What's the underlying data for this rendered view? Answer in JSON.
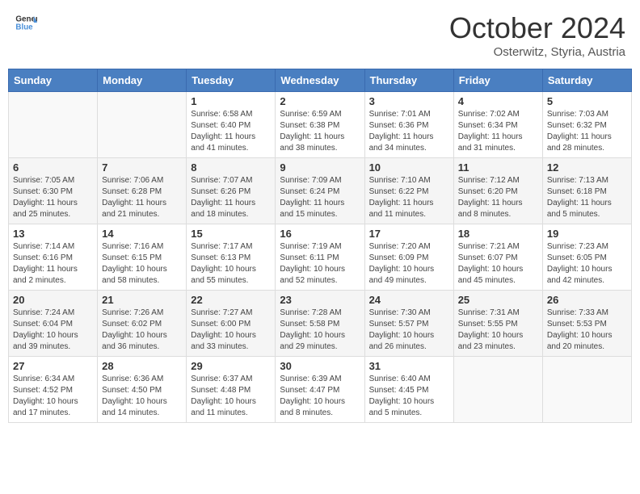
{
  "header": {
    "logo_general": "General",
    "logo_blue": "Blue",
    "title": "October 2024",
    "location": "Osterwitz, Styria, Austria"
  },
  "calendar": {
    "weekdays": [
      "Sunday",
      "Monday",
      "Tuesday",
      "Wednesday",
      "Thursday",
      "Friday",
      "Saturday"
    ],
    "weeks": [
      [
        {
          "day": "",
          "info": ""
        },
        {
          "day": "",
          "info": ""
        },
        {
          "day": "1",
          "info": "Sunrise: 6:58 AM\nSunset: 6:40 PM\nDaylight: 11 hours and 41 minutes."
        },
        {
          "day": "2",
          "info": "Sunrise: 6:59 AM\nSunset: 6:38 PM\nDaylight: 11 hours and 38 minutes."
        },
        {
          "day": "3",
          "info": "Sunrise: 7:01 AM\nSunset: 6:36 PM\nDaylight: 11 hours and 34 minutes."
        },
        {
          "day": "4",
          "info": "Sunrise: 7:02 AM\nSunset: 6:34 PM\nDaylight: 11 hours and 31 minutes."
        },
        {
          "day": "5",
          "info": "Sunrise: 7:03 AM\nSunset: 6:32 PM\nDaylight: 11 hours and 28 minutes."
        }
      ],
      [
        {
          "day": "6",
          "info": "Sunrise: 7:05 AM\nSunset: 6:30 PM\nDaylight: 11 hours and 25 minutes."
        },
        {
          "day": "7",
          "info": "Sunrise: 7:06 AM\nSunset: 6:28 PM\nDaylight: 11 hours and 21 minutes."
        },
        {
          "day": "8",
          "info": "Sunrise: 7:07 AM\nSunset: 6:26 PM\nDaylight: 11 hours and 18 minutes."
        },
        {
          "day": "9",
          "info": "Sunrise: 7:09 AM\nSunset: 6:24 PM\nDaylight: 11 hours and 15 minutes."
        },
        {
          "day": "10",
          "info": "Sunrise: 7:10 AM\nSunset: 6:22 PM\nDaylight: 11 hours and 11 minutes."
        },
        {
          "day": "11",
          "info": "Sunrise: 7:12 AM\nSunset: 6:20 PM\nDaylight: 11 hours and 8 minutes."
        },
        {
          "day": "12",
          "info": "Sunrise: 7:13 AM\nSunset: 6:18 PM\nDaylight: 11 hours and 5 minutes."
        }
      ],
      [
        {
          "day": "13",
          "info": "Sunrise: 7:14 AM\nSunset: 6:16 PM\nDaylight: 11 hours and 2 minutes."
        },
        {
          "day": "14",
          "info": "Sunrise: 7:16 AM\nSunset: 6:15 PM\nDaylight: 10 hours and 58 minutes."
        },
        {
          "day": "15",
          "info": "Sunrise: 7:17 AM\nSunset: 6:13 PM\nDaylight: 10 hours and 55 minutes."
        },
        {
          "day": "16",
          "info": "Sunrise: 7:19 AM\nSunset: 6:11 PM\nDaylight: 10 hours and 52 minutes."
        },
        {
          "day": "17",
          "info": "Sunrise: 7:20 AM\nSunset: 6:09 PM\nDaylight: 10 hours and 49 minutes."
        },
        {
          "day": "18",
          "info": "Sunrise: 7:21 AM\nSunset: 6:07 PM\nDaylight: 10 hours and 45 minutes."
        },
        {
          "day": "19",
          "info": "Sunrise: 7:23 AM\nSunset: 6:05 PM\nDaylight: 10 hours and 42 minutes."
        }
      ],
      [
        {
          "day": "20",
          "info": "Sunrise: 7:24 AM\nSunset: 6:04 PM\nDaylight: 10 hours and 39 minutes."
        },
        {
          "day": "21",
          "info": "Sunrise: 7:26 AM\nSunset: 6:02 PM\nDaylight: 10 hours and 36 minutes."
        },
        {
          "day": "22",
          "info": "Sunrise: 7:27 AM\nSunset: 6:00 PM\nDaylight: 10 hours and 33 minutes."
        },
        {
          "day": "23",
          "info": "Sunrise: 7:28 AM\nSunset: 5:58 PM\nDaylight: 10 hours and 29 minutes."
        },
        {
          "day": "24",
          "info": "Sunrise: 7:30 AM\nSunset: 5:57 PM\nDaylight: 10 hours and 26 minutes."
        },
        {
          "day": "25",
          "info": "Sunrise: 7:31 AM\nSunset: 5:55 PM\nDaylight: 10 hours and 23 minutes."
        },
        {
          "day": "26",
          "info": "Sunrise: 7:33 AM\nSunset: 5:53 PM\nDaylight: 10 hours and 20 minutes."
        }
      ],
      [
        {
          "day": "27",
          "info": "Sunrise: 6:34 AM\nSunset: 4:52 PM\nDaylight: 10 hours and 17 minutes."
        },
        {
          "day": "28",
          "info": "Sunrise: 6:36 AM\nSunset: 4:50 PM\nDaylight: 10 hours and 14 minutes."
        },
        {
          "day": "29",
          "info": "Sunrise: 6:37 AM\nSunset: 4:48 PM\nDaylight: 10 hours and 11 minutes."
        },
        {
          "day": "30",
          "info": "Sunrise: 6:39 AM\nSunset: 4:47 PM\nDaylight: 10 hours and 8 minutes."
        },
        {
          "day": "31",
          "info": "Sunrise: 6:40 AM\nSunset: 4:45 PM\nDaylight: 10 hours and 5 minutes."
        },
        {
          "day": "",
          "info": ""
        },
        {
          "day": "",
          "info": ""
        }
      ]
    ]
  }
}
